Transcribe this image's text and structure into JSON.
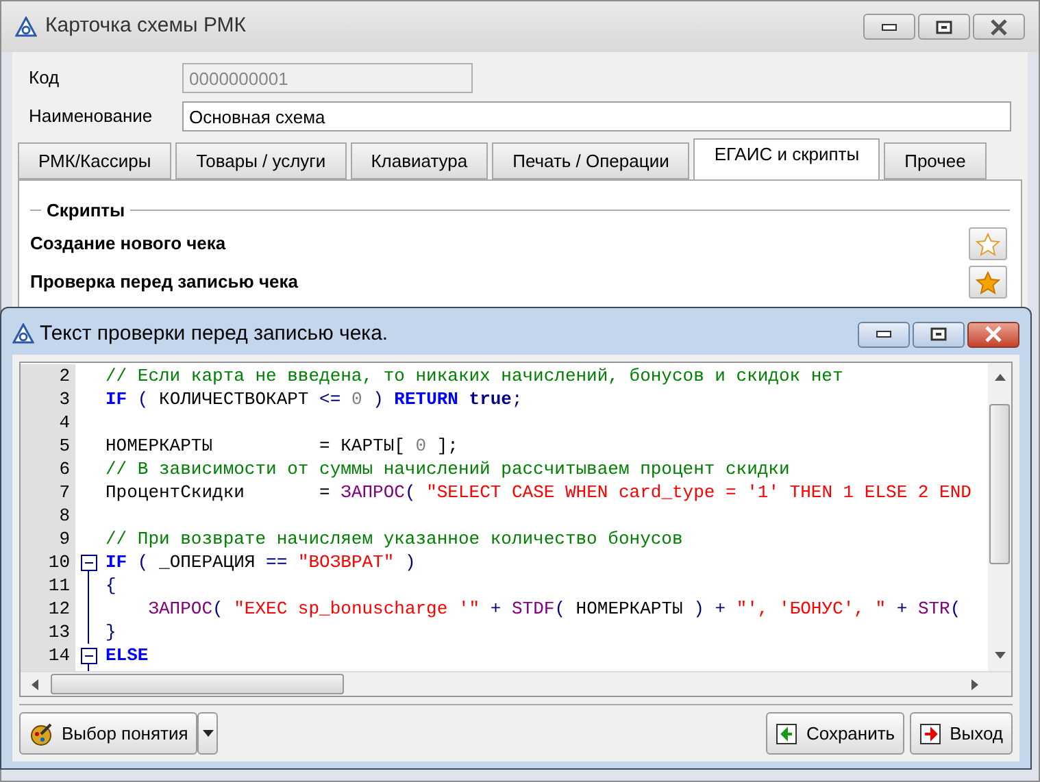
{
  "main_window": {
    "title": "Карточка схемы РМК",
    "fields": [
      {
        "label": "Код",
        "value": "0000000001",
        "disabled": true
      },
      {
        "label": "Наименование",
        "value": "Основная схема",
        "disabled": false
      }
    ],
    "tabs": [
      {
        "label": "РМК/Кассиры",
        "selected": false
      },
      {
        "label": "Товары / услуги",
        "selected": false
      },
      {
        "label": "Клавиатура",
        "selected": false
      },
      {
        "label": "Печать / Операции",
        "selected": false
      },
      {
        "label": "ЕГАИС и скрипты",
        "selected": true
      },
      {
        "label": "Прочее",
        "selected": false
      }
    ],
    "section": {
      "title": "Скрипты",
      "scripts": [
        {
          "label": "Создание нового чека",
          "starred": false
        },
        {
          "label": "Проверка перед записью чека",
          "starred": true
        }
      ]
    }
  },
  "dialog": {
    "title": "Текст проверки перед записью чека.",
    "lines": [
      {
        "number": "2",
        "fold": false,
        "tokens": [
          {
            "kind": "comment",
            "text": "// Если карта не введена, то никаких начислений, бонусов и скидок нет"
          }
        ]
      },
      {
        "number": "3",
        "fold": false,
        "tokens": [
          {
            "kind": "keyword",
            "text": "IF"
          },
          {
            "kind": "op",
            "text": " ( "
          },
          {
            "kind": "ident",
            "text": "КОЛИЧЕСТВОКАРТ"
          },
          {
            "kind": "op",
            "text": " <= "
          },
          {
            "kind": "number",
            "text": "0"
          },
          {
            "kind": "op",
            "text": " ) "
          },
          {
            "kind": "keyword",
            "text": "RETURN "
          },
          {
            "kind": "const",
            "text": "true"
          },
          {
            "kind": "op",
            "text": ";"
          }
        ]
      },
      {
        "number": "4",
        "fold": false
      },
      {
        "number": "5",
        "fold": false,
        "tokens": [
          {
            "kind": "ident",
            "text": "НОМЕРКАРТЫ          = КАРТЫ[ "
          },
          {
            "kind": "number",
            "text": "0"
          },
          {
            "kind": "ident",
            "text": " ];"
          }
        ]
      },
      {
        "number": "6",
        "fold": false,
        "tokens": [
          {
            "kind": "comment",
            "text": "// В зависимости от суммы начислений рассчитываем процент скидки"
          }
        ]
      },
      {
        "number": "7",
        "fold": false,
        "tokens": [
          {
            "kind": "ident",
            "text": "ПроцентСкидки       = "
          },
          {
            "kind": "func",
            "text": "ЗАПРОС"
          },
          {
            "kind": "op",
            "text": "( "
          },
          {
            "kind": "string",
            "text": "\"SELECT CASE WHEN card_type = '1' THEN 1 ELSE 2 END"
          }
        ]
      },
      {
        "number": "8",
        "fold": false
      },
      {
        "number": "9",
        "fold": false,
        "tokens": [
          {
            "kind": "comment",
            "text": "// При возврате начисляем указанное количество бонусов"
          }
        ]
      },
      {
        "number": "10",
        "fold": true,
        "tokens": [
          {
            "kind": "keyword",
            "text": "IF"
          },
          {
            "kind": "op",
            "text": " ( "
          },
          {
            "kind": "ident",
            "text": "_ОПЕРАЦИЯ"
          },
          {
            "kind": "op",
            "text": " == "
          },
          {
            "kind": "string",
            "text": "\"ВОЗВРАТ\""
          },
          {
            "kind": "op",
            "text": " )"
          }
        ]
      },
      {
        "number": "11",
        "fold": false,
        "tokens": [
          {
            "kind": "op",
            "text": "{"
          }
        ]
      },
      {
        "number": "12",
        "fold": false,
        "tokens": [
          {
            "kind": "func",
            "text": "    ЗАПРОС"
          },
          {
            "kind": "op",
            "text": "( "
          },
          {
            "kind": "string",
            "text": "\"EXEC sp_bonuscharge '\""
          },
          {
            "kind": "op",
            "text": " + "
          },
          {
            "kind": "func",
            "text": "STDF"
          },
          {
            "kind": "op",
            "text": "( "
          },
          {
            "kind": "ident",
            "text": "НОМЕРКАРТЫ"
          },
          {
            "kind": "op",
            "text": " ) + "
          },
          {
            "kind": "string",
            "text": "\"', 'БОНУС', \""
          },
          {
            "kind": "op",
            "text": " + "
          },
          {
            "kind": "func",
            "text": "STR"
          },
          {
            "kind": "op",
            "text": "("
          }
        ]
      },
      {
        "number": "13",
        "fold": false,
        "tokens": [
          {
            "kind": "op",
            "text": "}"
          }
        ]
      },
      {
        "number": "14",
        "fold": true,
        "tokens": [
          {
            "kind": "keyword",
            "text": "ELSE"
          }
        ]
      }
    ],
    "buttons": [
      {
        "label": "Выбор понятия",
        "kind": "concept"
      },
      {
        "label": "Сохранить",
        "kind": "save"
      },
      {
        "label": "Выход",
        "kind": "exit"
      }
    ]
  }
}
